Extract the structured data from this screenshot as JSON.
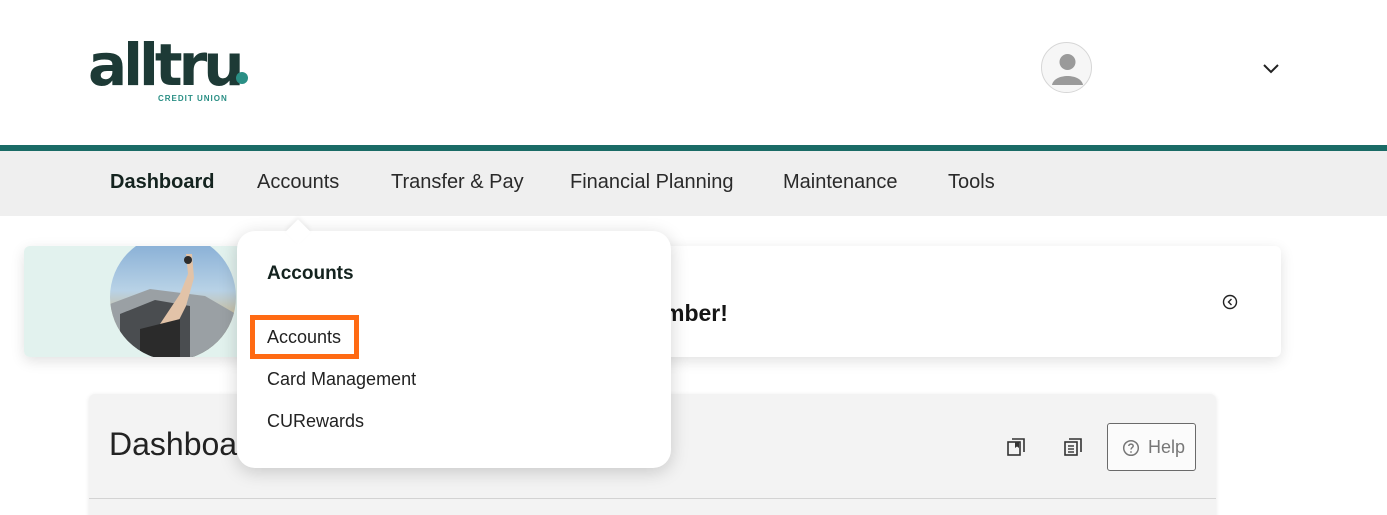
{
  "header": {
    "logo": {
      "wordmark": "alltru",
      "subtitle": "CREDIT UNION"
    },
    "avatar_icon": "user-avatar-icon",
    "menu_icon": "chevron-down-icon"
  },
  "nav": {
    "items": [
      {
        "label": "Dashboard",
        "active": true
      },
      {
        "label": "Accounts",
        "active": false
      },
      {
        "label": "Transfer & Pay",
        "active": false
      },
      {
        "label": "Financial Planning",
        "active": false
      },
      {
        "label": "Maintenance",
        "active": false
      },
      {
        "label": "Tools",
        "active": false
      }
    ]
  },
  "banner": {
    "text_visible": "mber!",
    "close_icon": "circle-chevron-left-icon"
  },
  "dashboard": {
    "title_visible": "Dashboa",
    "help_label": "Help",
    "icons": [
      "bookmark-list-icon",
      "list-view-icon",
      "help-circle-icon"
    ]
  },
  "dropdown": {
    "heading": "Accounts",
    "links": [
      "Accounts",
      "Card Management",
      "CURewards"
    ]
  },
  "colors": {
    "brand_dark": "#1d3a36",
    "brand_teal": "#2a8f85",
    "nav_bar": "#1a6b66",
    "highlight": "#ff6a13"
  }
}
